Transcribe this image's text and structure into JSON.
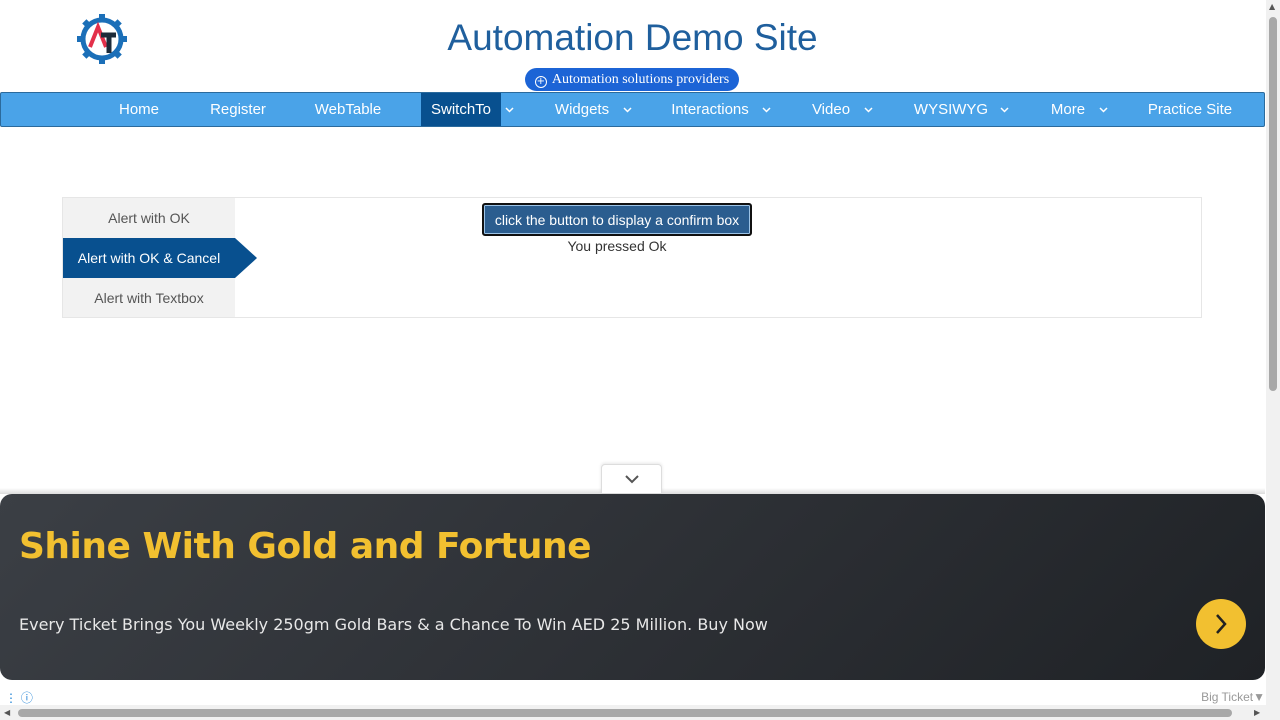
{
  "header": {
    "title": "Automation Demo Site",
    "tagline": "Automation solutions providers",
    "logo_icon": "gear-logo-icon"
  },
  "nav": {
    "items": [
      {
        "label": "Home",
        "dropdown": false,
        "active": false
      },
      {
        "label": "Register",
        "dropdown": false,
        "active": false
      },
      {
        "label": "WebTable",
        "dropdown": false,
        "active": false
      },
      {
        "label": "SwitchTo",
        "dropdown": true,
        "active": true
      },
      {
        "label": "Widgets",
        "dropdown": true,
        "active": false
      },
      {
        "label": "Interactions",
        "dropdown": true,
        "active": false
      },
      {
        "label": "Video",
        "dropdown": true,
        "active": false
      },
      {
        "label": "WYSIWYG",
        "dropdown": true,
        "active": false
      },
      {
        "label": "More",
        "dropdown": true,
        "active": false
      },
      {
        "label": "Practice Site",
        "dropdown": false,
        "active": false
      }
    ]
  },
  "alerts": {
    "tabs": [
      "Alert with OK",
      "Alert with OK & Cancel",
      "Alert with Textbox"
    ],
    "active_tab": 1,
    "button_label": "click the button to display a confirm box",
    "result_text": "You pressed Ok"
  },
  "ad": {
    "title": "Shine With Gold and Fortune",
    "text": "Every Ticket Brings You Weekly 250gm Gold Bars & a Chance To Win AED 25 Million. Buy Now",
    "brand": "Big Ticket",
    "brand_marker": "▼"
  },
  "colors": {
    "nav_bg": "#4aa3e8",
    "nav_active": "#08508f",
    "title": "#1f5f9d",
    "ad_accent": "#f2c030"
  }
}
